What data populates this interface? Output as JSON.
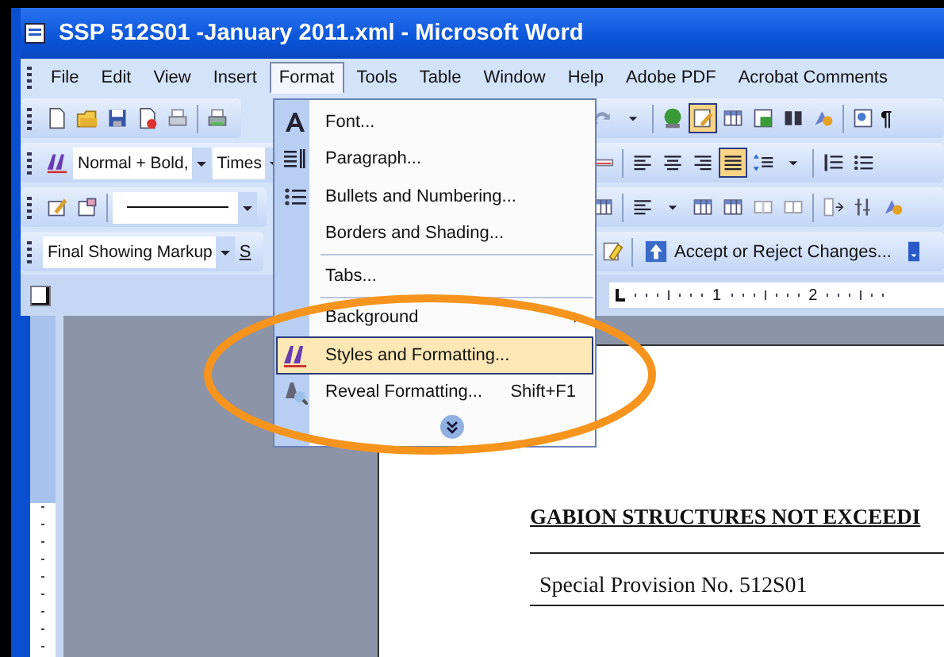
{
  "window": {
    "title": "SSP 512S01 -January 2011.xml - Microsoft Word"
  },
  "menu_bar": [
    {
      "label": "File",
      "selected": false
    },
    {
      "label": "Edit",
      "selected": false
    },
    {
      "label": "View",
      "selected": false
    },
    {
      "label": "Insert",
      "selected": false
    },
    {
      "label": "Format",
      "selected": true
    },
    {
      "label": "Tools",
      "selected": false
    },
    {
      "label": "Table",
      "selected": false
    },
    {
      "label": "Window",
      "selected": false
    },
    {
      "label": "Help",
      "selected": false
    },
    {
      "label": "Adobe PDF",
      "selected": false
    },
    {
      "label": "Acrobat Comments",
      "selected": false
    }
  ],
  "toolbars": [
    {
      "left": [
        {
          "kind": "new",
          "pressed": false
        },
        {
          "kind": "open",
          "pressed": false
        },
        {
          "kind": "save",
          "pressed": false
        },
        {
          "kind": "permission",
          "pressed": false
        },
        {
          "kind": "printer",
          "pressed": false
        },
        {
          "kind": "sep"
        },
        {
          "kind": "print",
          "pressed": false
        }
      ],
      "right": [
        {
          "kind": "redo",
          "pressed": false
        },
        {
          "kind": "dropdown",
          "pressed": false
        },
        {
          "kind": "sep"
        },
        {
          "kind": "globe",
          "pressed": false
        },
        {
          "kind": "edit",
          "pressed": true
        },
        {
          "kind": "table",
          "pressed": false
        },
        {
          "kind": "excel",
          "pressed": false
        },
        {
          "kind": "columns",
          "pressed": false
        },
        {
          "kind": "drawing",
          "pressed": false
        },
        {
          "kind": "sep"
        },
        {
          "kind": "docmap",
          "pressed": false
        },
        {
          "kind": "glyph",
          "text": "¶"
        }
      ]
    },
    {
      "left": [
        {
          "kind": "styles",
          "pressed": false
        },
        {
          "kind": "combo",
          "text": "Normal + Bold,"
        },
        {
          "kind": "combo",
          "text": "Times"
        }
      ],
      "right": [
        {
          "kind": "abc",
          "pressed": false
        },
        {
          "kind": "sep"
        },
        {
          "kind": "align-left",
          "pressed": false
        },
        {
          "kind": "align-center",
          "pressed": false
        },
        {
          "kind": "align-right",
          "pressed": false
        },
        {
          "kind": "justify",
          "pressed": true
        },
        {
          "kind": "line-spacing",
          "pressed": false
        },
        {
          "kind": "dropdown",
          "pressed": false
        },
        {
          "kind": "sep"
        },
        {
          "kind": "numbering",
          "pressed": false
        },
        {
          "kind": "bullets",
          "pressed": false
        }
      ]
    },
    {
      "left": [
        {
          "kind": "draw-table",
          "pressed": false
        },
        {
          "kind": "eraser",
          "pressed": false
        },
        {
          "kind": "sep"
        },
        {
          "kind": "line-combo"
        }
      ],
      "right": [
        {
          "kind": "table",
          "pressed": false
        },
        {
          "kind": "sep"
        },
        {
          "kind": "align-left",
          "pressed": false
        },
        {
          "kind": "dropdown",
          "pressed": false
        },
        {
          "kind": "table",
          "pressed": false
        },
        {
          "kind": "table",
          "pressed": false
        },
        {
          "kind": "merge",
          "pressed": false
        },
        {
          "kind": "split",
          "pressed": false
        },
        {
          "kind": "sep"
        },
        {
          "kind": "distribute",
          "pressed": false
        },
        {
          "kind": "sort",
          "pressed": false
        },
        {
          "kind": "drawing",
          "pressed": false
        }
      ]
    },
    {
      "left": [
        {
          "kind": "combo",
          "text": "Final Showing Markup"
        },
        {
          "kind": "label",
          "text": "S"
        }
      ],
      "right": [
        {
          "kind": "sep"
        },
        {
          "kind": "highlighter",
          "pressed": false
        },
        {
          "kind": "sep"
        },
        {
          "kind": "accept",
          "text": "Accept or Reject Changes..."
        },
        {
          "kind": "chevron",
          "pressed": false
        }
      ]
    }
  ],
  "ruler": {
    "labels": [
      "1",
      "2"
    ]
  },
  "format_menu": [
    {
      "kind": "item",
      "label": "Font...",
      "selected": false
    },
    {
      "kind": "item",
      "label": "Paragraph...",
      "selected": false
    },
    {
      "kind": "item",
      "label": "Bullets and Numbering...",
      "selected": false
    },
    {
      "kind": "item",
      "label": "Borders and Shading...",
      "selected": false
    },
    {
      "kind": "separator"
    },
    {
      "kind": "item",
      "label": "Tabs...",
      "selected": false
    },
    {
      "kind": "separator"
    },
    {
      "kind": "submenu",
      "label": "Background",
      "selected": false
    },
    {
      "kind": "item",
      "label": "Styles and Formatting...",
      "selected": true
    },
    {
      "kind": "item",
      "label": "Reveal Formatting...",
      "shortcut": "Shift+F1",
      "selected": false
    },
    {
      "kind": "expand"
    }
  ],
  "document": {
    "heading": "GABION STRUCTURES NOT EXCEEDI",
    "provision": "Special Provision No. 512S01"
  }
}
